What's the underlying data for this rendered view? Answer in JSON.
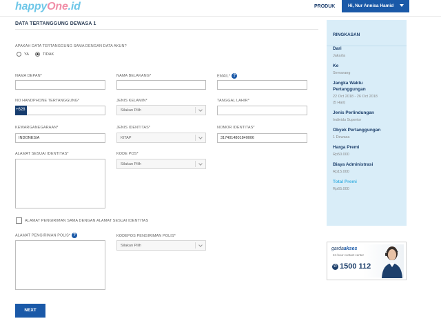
{
  "header": {
    "logo_part1": "happy",
    "logo_part2": "One",
    "logo_part3": ".id",
    "nav_produk": "PRODUK",
    "user_menu": "Hi, Nur Annisa Hamid"
  },
  "form": {
    "section_title": "DATA TERTANGGUNG DEWASA 1",
    "same_as_account_question": "APAKAH DATA TERTANGGUNG SAMA DENGAN DATA AKUN?",
    "radio_ya": "YA",
    "radio_tidak": "TIDAK",
    "radio_selected": "TIDAK",
    "first_name_label": "NAMA DEPAN*",
    "last_name_label": "NAMA BELAKANG*",
    "email_label": "EMAIL*",
    "phone_label": "NO HANDPHONE TERTANGGUNG*",
    "phone_prefix": "+628",
    "gender_label": "JENIS KELAMIN*",
    "gender_placeholder": "Silakan Pilih",
    "dob_label": "TANGGAL LAHIR*",
    "nationality_label": "KEWARGANEGARAAN*",
    "nationality_value": "INDONESIA",
    "id_type_label": "JENIS IDENTITAS*",
    "id_type_value": "KITAP",
    "id_number_label": "NOMOR IDENTITAS*",
    "id_number_value": "3174014801840006",
    "address_label": "ALAMAT SESUAI IDENTITAS*",
    "postal_label": "KODE POS*",
    "postal_placeholder": "Silakan Pilih",
    "same_address_checkbox": "ALAMAT PENGIRIMAN SAMA DENGAN ALAMAT SESUAI IDENTITAS",
    "policy_address_label": "ALAMAT PENGIRIMAN POLIS*",
    "policy_postal_label": "KODEPOS PENGIRIMAN POLIS*",
    "policy_postal_placeholder": "Silakan Pilih",
    "next_button": "NEXT"
  },
  "summary": {
    "title": "RINGKASAN",
    "dari_label": "Dari",
    "dari_value": "Jakarta",
    "ke_label": "Ke",
    "ke_value": "Semarang",
    "jangka_label_1": "Jangka Waktu",
    "jangka_label_2": "Pertanggungan",
    "jangka_value": "22 Oct 2018 - 26 Oct 2018",
    "jangka_days": "(5 Hari)",
    "perlindungan_label": "Jenis Perlindungan",
    "perlindungan_value": "Individu Superior",
    "obyek_label": "Obyek Pertanggungan",
    "obyek_value": "1 Dewasa",
    "premi_label": "Harga Premi",
    "premi_value": "Rp50.000",
    "admin_label": "Biaya Administrasi",
    "admin_value": "Rp15.000",
    "total_label": "Total Premi",
    "total_value": "Rp65.000"
  },
  "ad": {
    "brand_part1": "garda",
    "brand_part2": "akses",
    "subtitle": "24-hour contact center",
    "number": "1500 112"
  },
  "colors": {
    "primary_blue": "#1a59a8",
    "navy": "#163c6e",
    "summary_bg": "#d9edf8",
    "total_accent": "#46b4e3",
    "logo_cyan": "#6fc7e8",
    "logo_pink": "#f08fa8"
  },
  "icons": [
    "help-icon",
    "chevron-down-icon",
    "phone-icon",
    "radio-button",
    "checkbox"
  ]
}
